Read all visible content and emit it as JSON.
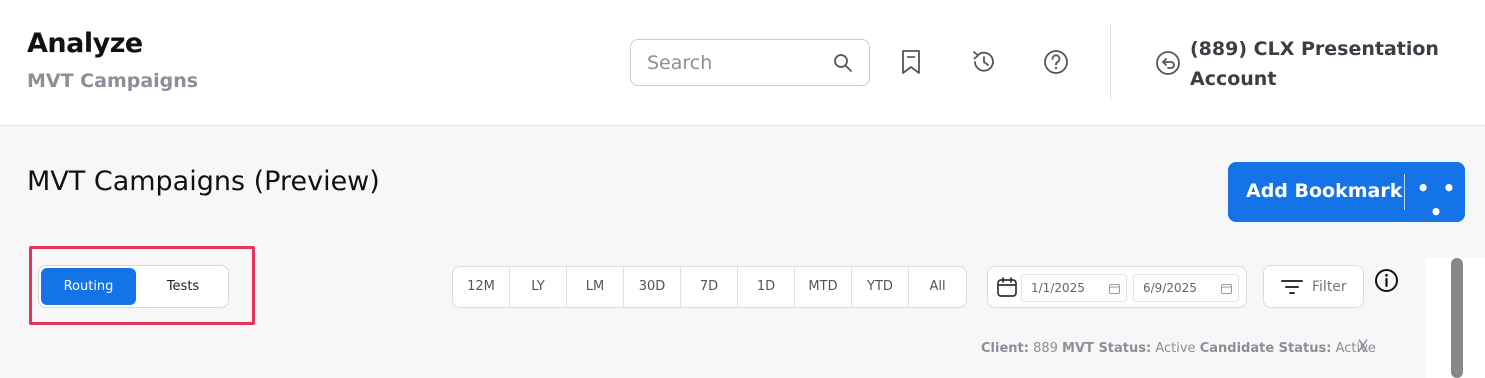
{
  "header": {
    "title": "Analyze",
    "subtitle": "MVT Campaigns",
    "search_placeholder": "Search",
    "icons": [
      "search-icon",
      "bookmark-icon",
      "history-icon",
      "help-icon",
      "switch-account-icon"
    ],
    "account_name": "(889) CLX Presentation Account"
  },
  "page": {
    "title": "MVT Campaigns (Preview)",
    "add_bookmark_label": "Add Bookmark",
    "more_label": "• • •"
  },
  "view_toggle": {
    "options": [
      "Routing",
      "Tests"
    ],
    "selected": "Routing"
  },
  "date_ranges": [
    "12M",
    "LY",
    "LM",
    "30D",
    "7D",
    "1D",
    "MTD",
    "YTD",
    "All"
  ],
  "date_picker": {
    "start": "1/1/2025",
    "end": "6/9/2025"
  },
  "filter_label": "Filter",
  "status": {
    "client_label": "Client:",
    "client_value": "889",
    "mvt_status_label": "MVT Status:",
    "mvt_status_value": "Active",
    "candidate_status_label": "Candidate Status:",
    "candidate_status_value": "Active",
    "close_label": "X"
  },
  "colors": {
    "primary": "#1473e6",
    "highlight": "#e8335f",
    "muted_text": "#8a8f98"
  }
}
